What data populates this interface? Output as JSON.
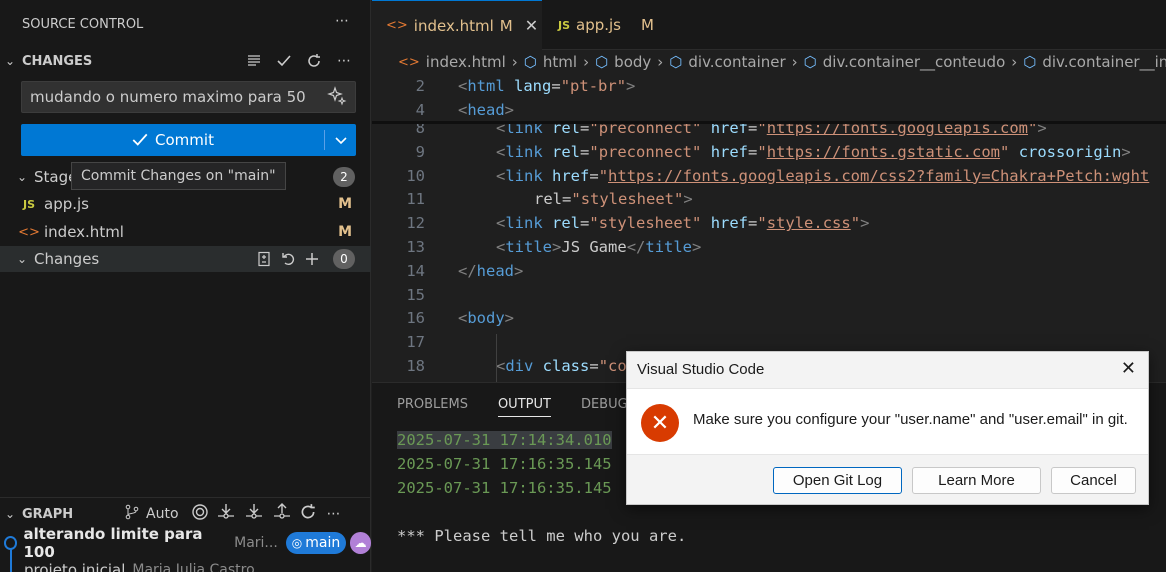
{
  "sidebar": {
    "title": "SOURCE CONTROL",
    "changes_header": "CHANGES",
    "commit_message": "mudando o numero maximo para 50",
    "commit_label": "Commit",
    "tooltip": "Commit Changes on \"main\"",
    "staged_label": "Stage",
    "staged_count": "2",
    "staged_files": [
      {
        "name": "app.js",
        "status": "M",
        "type": "js"
      },
      {
        "name": "index.html",
        "status": "M",
        "type": "html"
      }
    ],
    "changes_label": "Changes",
    "changes_count": "0",
    "graph_header": "GRAPH",
    "graph_auto": "Auto",
    "graph_items": [
      {
        "message": "alterando limite para 100",
        "author": "Mari...",
        "branch": "main"
      },
      {
        "message": "projeto inicial",
        "author": "Maria Julia Castro"
      }
    ]
  },
  "tabs": [
    {
      "label": "index.html",
      "status": "M",
      "icon": "html-icon"
    },
    {
      "label": "app.js",
      "status": "M",
      "icon": "js-icon"
    }
  ],
  "breadcrumbs": [
    "index.html",
    "html",
    "body",
    "div.container",
    "div.container__conteudo",
    "div.container__in"
  ],
  "code": {
    "sticky": [
      {
        "n": "2",
        "text": "<html lang=\"pt-br\">"
      },
      {
        "n": "4",
        "text": "<head>"
      }
    ],
    "lines": [
      {
        "n": "8",
        "text": "<link rel=\"preconnect\" href=\"https://fonts.googleapis.com\">"
      },
      {
        "n": "9",
        "text": "<link rel=\"preconnect\" href=\"https://fonts.gstatic.com\" crossorigin>"
      },
      {
        "n": "10",
        "text": "<link href=\"https://fonts.googleapis.com/css2?family=Chakra+Petch:wght"
      },
      {
        "n": "11",
        "text": "rel=\"stylesheet\">"
      },
      {
        "n": "12",
        "text": "<link rel=\"stylesheet\" href=\"style.css\">"
      },
      {
        "n": "13",
        "text": "<title>JS Game</title>"
      },
      {
        "n": "14",
        "text": "</head>"
      },
      {
        "n": "15",
        "text": ""
      },
      {
        "n": "16",
        "text": "<body>"
      },
      {
        "n": "17",
        "text": ""
      },
      {
        "n": "18",
        "text": "<div class=\"co"
      }
    ]
  },
  "panel": {
    "tabs": [
      "PROBLEMS",
      "OUTPUT",
      "DEBUG C"
    ],
    "output_lines": [
      "2025-07-31 17:14:34.010",
      "2025-07-31 17:16:35.145",
      "2025-07-31 17:16:35.145",
      "",
      "*** Please tell me who you are."
    ]
  },
  "dialog": {
    "title": "Visual Studio Code",
    "message": "Make sure you configure your \"user.name\" and \"user.email\" in git.",
    "buttons": [
      "Open Git Log",
      "Learn More",
      "Cancel"
    ]
  }
}
